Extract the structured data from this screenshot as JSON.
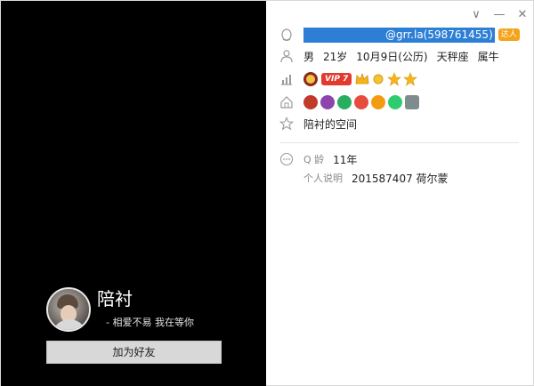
{
  "left": {
    "nickname": "陪衬",
    "signature": "-  相爱不易  我在等你",
    "add_friend_label": "加为好友"
  },
  "controls": {
    "chevron": "∨",
    "minimize": "—",
    "close": "✕"
  },
  "info": {
    "account_suffix": "@grr.la(598761455)",
    "daren_label": "达人",
    "gender": "男",
    "age": "21岁",
    "birthday": "10月9日(公历)",
    "constellation": "天秤座",
    "zodiac": "属牛",
    "vip_label": "VIP 7",
    "space_label": "陪衬的空间",
    "qage_label": "Q 龄",
    "qage_value": "11年",
    "personal_label": "个人说明",
    "personal_value": "201587407 荷尔蒙"
  },
  "icons": {
    "account": "qq-penguin-icon",
    "profile": "user-icon",
    "level": "level-chart-icon",
    "space": "home-icon",
    "star": "star-outline-icon",
    "more": "more-circle-icon"
  },
  "colors": {
    "selection": "#2d7fd6",
    "vip_red": "#e23a2d",
    "gold": "#f5b51a"
  }
}
